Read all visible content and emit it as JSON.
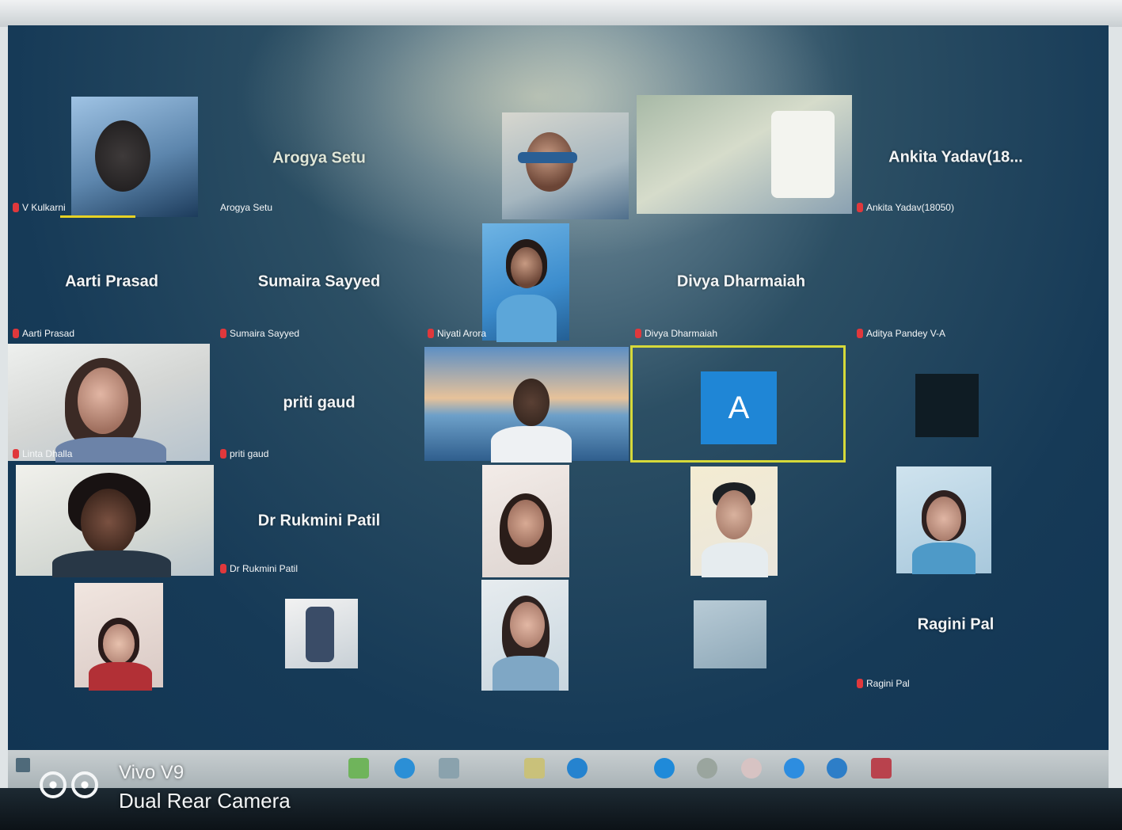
{
  "meeting": {
    "participants": [
      {
        "big_name": "",
        "label": "V Kulkarni",
        "video": true
      },
      {
        "big_name": "Arogya Setu",
        "label": "Arogya Setu",
        "video": false
      },
      {
        "big_name": "",
        "label": "",
        "video": true
      },
      {
        "big_name": "",
        "label": "",
        "video": true
      },
      {
        "big_name": "Ankita Yadav(18...",
        "label": "Ankita Yadav(18050)",
        "video": false
      },
      {
        "big_name": "Aarti Prasad",
        "label": "Aarti Prasad",
        "video": false
      },
      {
        "big_name": "Sumaira Sayyed",
        "label": "Sumaira Sayyed",
        "video": false
      },
      {
        "big_name": "",
        "label": "Niyati Arora",
        "video": true
      },
      {
        "big_name": "Divya Dharmaiah",
        "label": "Divya Dharmaiah",
        "video": false
      },
      {
        "big_name": "",
        "label": "Aditya Pandey V-A",
        "video": false
      },
      {
        "big_name": "",
        "label": "Linta Dhalla",
        "video": true
      },
      {
        "big_name": "priti gaud",
        "label": "priti gaud",
        "video": false
      },
      {
        "big_name": "",
        "label": "",
        "video": true
      },
      {
        "big_name": "",
        "label": "",
        "video": false,
        "avatar_letter": "A"
      },
      {
        "big_name": "",
        "label": "",
        "video": false
      },
      {
        "big_name": "",
        "label": "",
        "video": true
      },
      {
        "big_name": "Dr Rukmini Patil",
        "label": "Dr Rukmini Patil",
        "video": false
      },
      {
        "big_name": "",
        "label": "",
        "video": true
      },
      {
        "big_name": "",
        "label": "",
        "video": true
      },
      {
        "big_name": "",
        "label": "",
        "video": true
      },
      {
        "big_name": "",
        "label": "",
        "video": true
      },
      {
        "big_name": "",
        "label": "",
        "video": true
      },
      {
        "big_name": "",
        "label": "",
        "video": true
      },
      {
        "big_name": "",
        "label": "",
        "video": true
      },
      {
        "big_name": "Ragini Pal",
        "label": "Ragini Pal",
        "video": false
      }
    ],
    "muted_indicator_color": "#e0383c",
    "active_speaker_border_color": "#d6d93a",
    "avatar_color": "#1f86d6"
  },
  "taskbar": {
    "icons": [
      "start-icon",
      "file-explorer-icon",
      "edge-browser-icon",
      "store-icon",
      "folder-icon",
      "mail-icon",
      "chrome-icon",
      "photos-icon",
      "media-icon",
      "zoom-icon",
      "settings-icon",
      "camera-app-icon"
    ]
  },
  "camera_watermark": {
    "model": "Vivo V9",
    "caption": "Dual Rear Camera"
  }
}
